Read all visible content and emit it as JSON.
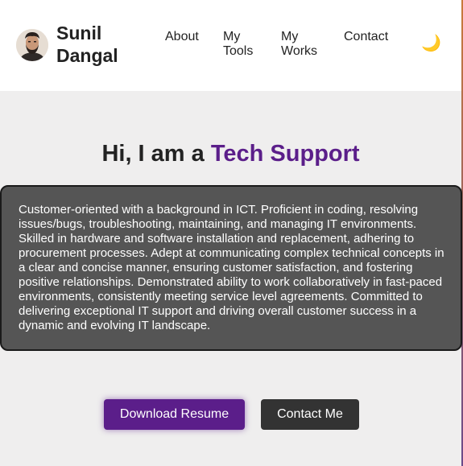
{
  "header": {
    "name": "Sunil Dangal",
    "nav": [
      {
        "label": "About"
      },
      {
        "label": "My Tools"
      },
      {
        "label": "My Works"
      },
      {
        "label": "Contact"
      }
    ],
    "theme_toggle_glyph": "🌙",
    "theme_toggle_icon": "moon-icon"
  },
  "hero": {
    "greeting": "Hi, I am a ",
    "role": "Tech Support",
    "about_text": "Customer-oriented with a background in ICT. Proficient in coding, resolving issues/bugs, troubleshooting, maintaining, and managing IT environments. Skilled in hardware and software installation and replacement, adhering to procurement processes. Adept at communicating complex technical concepts in a clear and concise manner, ensuring customer satisfaction, and fostering positive relationships. Demonstrated ability to work collaboratively in fast-paced environments, consistently meeting service level agreements. Committed to delivering exceptional IT support and driving overall customer success in a dynamic and evolving IT landscape.",
    "download_label": "Download Resume",
    "contact_label": "Contact Me"
  },
  "colors": {
    "accent": "#5b1e8a",
    "background": "#efeeee",
    "card": "#555555",
    "dark_button": "#333333"
  }
}
